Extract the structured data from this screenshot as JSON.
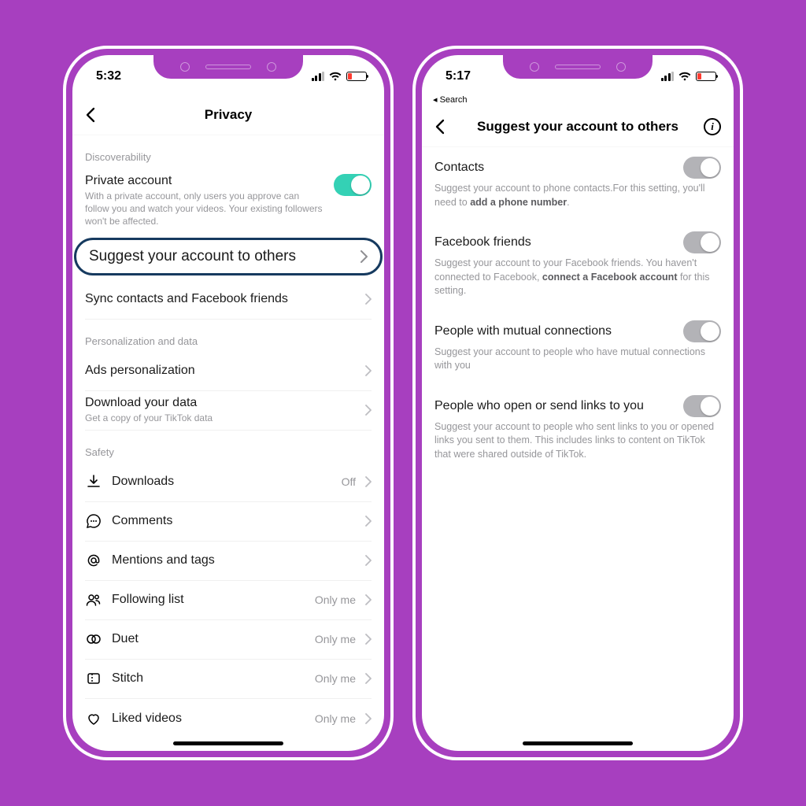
{
  "left": {
    "status_time": "5:32",
    "nav_title": "Privacy",
    "sections": {
      "discoverability": {
        "label": "Discoverability",
        "private_account": {
          "title": "Private account",
          "sub": "With a private account, only users you approve can follow you and watch your videos. Your existing followers won't be affected.",
          "on": true
        },
        "suggest": {
          "title": "Suggest your account to others"
        },
        "sync": {
          "title": "Sync contacts and Facebook friends"
        }
      },
      "personalization": {
        "label": "Personalization and data",
        "ads": {
          "title": "Ads personalization"
        },
        "download": {
          "title": "Download your data",
          "sub": "Get a copy of your TikTok data"
        }
      },
      "safety": {
        "label": "Safety",
        "downloads": {
          "title": "Downloads",
          "value": "Off"
        },
        "comments": {
          "title": "Comments"
        },
        "mentions": {
          "title": "Mentions and tags"
        },
        "following": {
          "title": "Following list",
          "value": "Only me"
        },
        "duet": {
          "title": "Duet",
          "value": "Only me"
        },
        "stitch": {
          "title": "Stitch",
          "value": "Only me"
        },
        "liked": {
          "title": "Liked videos",
          "value": "Only me"
        }
      }
    }
  },
  "right": {
    "status_time": "5:17",
    "back_label": "◂ Search",
    "nav_title": "Suggest your account to others",
    "options": {
      "contacts": {
        "title": "Contacts",
        "sub_pre": "Suggest your account to phone contacts.For this setting, you'll need to ",
        "sub_bold": "add a phone number",
        "sub_post": "."
      },
      "facebook": {
        "title": "Facebook friends",
        "sub_pre": "Suggest your account to your Facebook friends. You haven't connected to Facebook, ",
        "sub_bold": "connect a Facebook account",
        "sub_post": " for this setting."
      },
      "mutual": {
        "title": "People with mutual connections",
        "sub": "Suggest your account to people who have mutual connections with you"
      },
      "links": {
        "title": "People who open or send links to you",
        "sub": "Suggest your account to people who sent links to you or opened links you sent to them. This includes links to content on TikTok that were shared outside of TikTok."
      }
    }
  }
}
